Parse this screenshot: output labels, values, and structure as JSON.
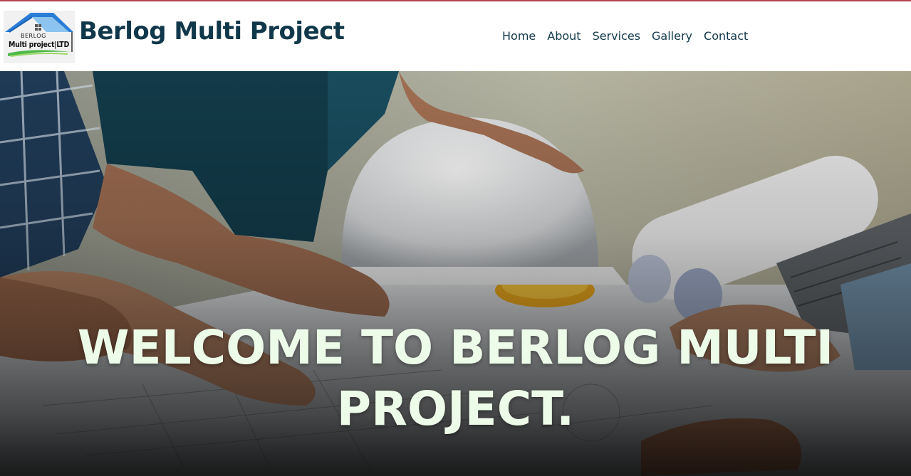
{
  "header": {
    "logo": {
      "line1": "BERLOG",
      "line2": "Multi project|LTD"
    },
    "title": "Berlog Multi Project",
    "nav": [
      {
        "label": "Home"
      },
      {
        "label": "About"
      },
      {
        "label": "Services"
      },
      {
        "label": "Gallery"
      },
      {
        "label": "Contact"
      }
    ]
  },
  "hero": {
    "headline_line1": "WELCOME TO BERLOG MULTI",
    "headline_line2": "PROJECT."
  },
  "colors": {
    "brand_text": "#10384a",
    "top_border": "#b8434f",
    "hero_text": "#edfbe9"
  }
}
